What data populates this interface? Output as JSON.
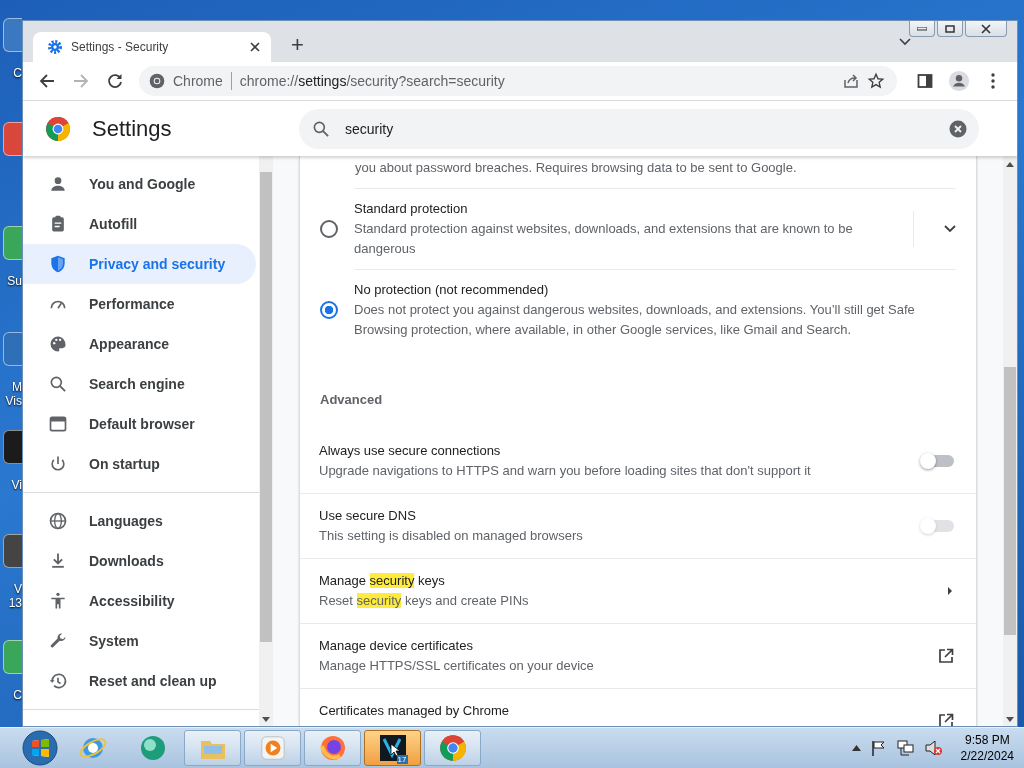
{
  "desktop": {
    "icons": [
      {
        "kind": "app",
        "lines": [
          "C"
        ]
      },
      {
        "kind": "app"
      },
      {
        "kind": "app",
        "lines": [
          "Su"
        ]
      },
      {
        "kind": "app",
        "lines": [
          "M",
          "Vis"
        ]
      },
      {
        "kind": "app",
        "lines": [
          "Vi"
        ]
      },
      {
        "kind": "app",
        "lines": [
          "V",
          "13"
        ]
      },
      {
        "kind": "app",
        "lines": [
          "C"
        ]
      }
    ]
  },
  "browser": {
    "tabs": [
      {
        "title": "Settings - Security",
        "selected": true
      }
    ],
    "new_tab": "+",
    "address": {
      "chip": "Chrome",
      "url_host": "chrome://",
      "url_path": "settings",
      "url_rest": "/security?search=security"
    }
  },
  "settings": {
    "title": "Settings",
    "search": {
      "value": "security"
    },
    "sidebar": {
      "groups": [
        [
          {
            "kind": "person",
            "label": "You and Google",
            "selected": false
          },
          {
            "kind": "clipboard",
            "label": "Autofill",
            "selected": false
          },
          {
            "kind": "shield",
            "label": "Privacy and security",
            "selected": true
          },
          {
            "kind": "gauge",
            "label": "Performance",
            "selected": false
          },
          {
            "kind": "palette",
            "label": "Appearance",
            "selected": false
          },
          {
            "kind": "search",
            "label": "Search engine",
            "selected": false
          },
          {
            "kind": "window",
            "label": "Default browser",
            "selected": false
          },
          {
            "kind": "power",
            "label": "On startup",
            "selected": false
          }
        ],
        [
          {
            "kind": "globe",
            "label": "Languages",
            "selected": false
          },
          {
            "kind": "download",
            "label": "Downloads",
            "selected": false
          },
          {
            "kind": "accessibility",
            "label": "Accessibility",
            "selected": false
          },
          {
            "kind": "wrench",
            "label": "System",
            "selected": false
          },
          {
            "kind": "history",
            "label": "Reset and clean up",
            "selected": false
          }
        ]
      ]
    },
    "content": {
      "partial_text": "you about password breaches. Requires browsing data to be sent to Google.",
      "protection_options": [
        {
          "title": "Standard protection",
          "description": "Standard protection against websites, downloads, and extensions that are known to be dangerous",
          "selected": false,
          "expandable": true
        },
        {
          "title": "No protection (not recommended)",
          "description": "Does not protect you against dangerous websites, downloads, and extensions. You’ll still get Safe Browsing protection, where available, in other Google services, like Gmail and Search.",
          "selected": true,
          "expandable": false
        }
      ],
      "section_heading": "Advanced",
      "rows": [
        {
          "kind": "toggle",
          "title": [
            {
              "text": "Always use secure connections"
            }
          ],
          "description": [
            {
              "text": "Upgrade navigations to HTTPS and warn you before loading sites that don't support it"
            }
          ],
          "on": false,
          "disabled": false
        },
        {
          "kind": "toggle",
          "title": [
            {
              "text": "Use secure DNS"
            }
          ],
          "description": [
            {
              "text": "This setting is disabled on managed browsers"
            }
          ],
          "on": false,
          "disabled": true
        },
        {
          "kind": "subpage",
          "title": [
            {
              "text": "Manage "
            },
            {
              "text": "security",
              "highlighted": true
            },
            {
              "text": " keys"
            }
          ],
          "description": [
            {
              "text": "Reset "
            },
            {
              "text": "security",
              "highlighted": true
            },
            {
              "text": " keys and create PINs"
            }
          ]
        },
        {
          "kind": "external",
          "title": [
            {
              "text": "Manage device certificates"
            }
          ],
          "description": [
            {
              "text": "Manage HTTPS/SSL certificates on your device"
            }
          ]
        },
        {
          "kind": "external",
          "title": [
            {
              "text": "Certificates managed by Chrome"
            }
          ]
        }
      ]
    }
  },
  "taskbar": {
    "apps": [
      {
        "kind": "ie",
        "open": false,
        "active": false
      },
      {
        "kind": "orb",
        "open": false,
        "active": false
      },
      {
        "kind": "folder",
        "open": true,
        "active": false
      },
      {
        "kind": "media",
        "open": true,
        "active": false
      },
      {
        "kind": "fox",
        "open": true,
        "active": false
      },
      {
        "kind": "vapp",
        "open": true,
        "active": true,
        "badge": "17"
      },
      {
        "kind": "chrome",
        "open": true,
        "active": false
      }
    ],
    "time": "9:58 PM",
    "date": "2/22/2024"
  }
}
